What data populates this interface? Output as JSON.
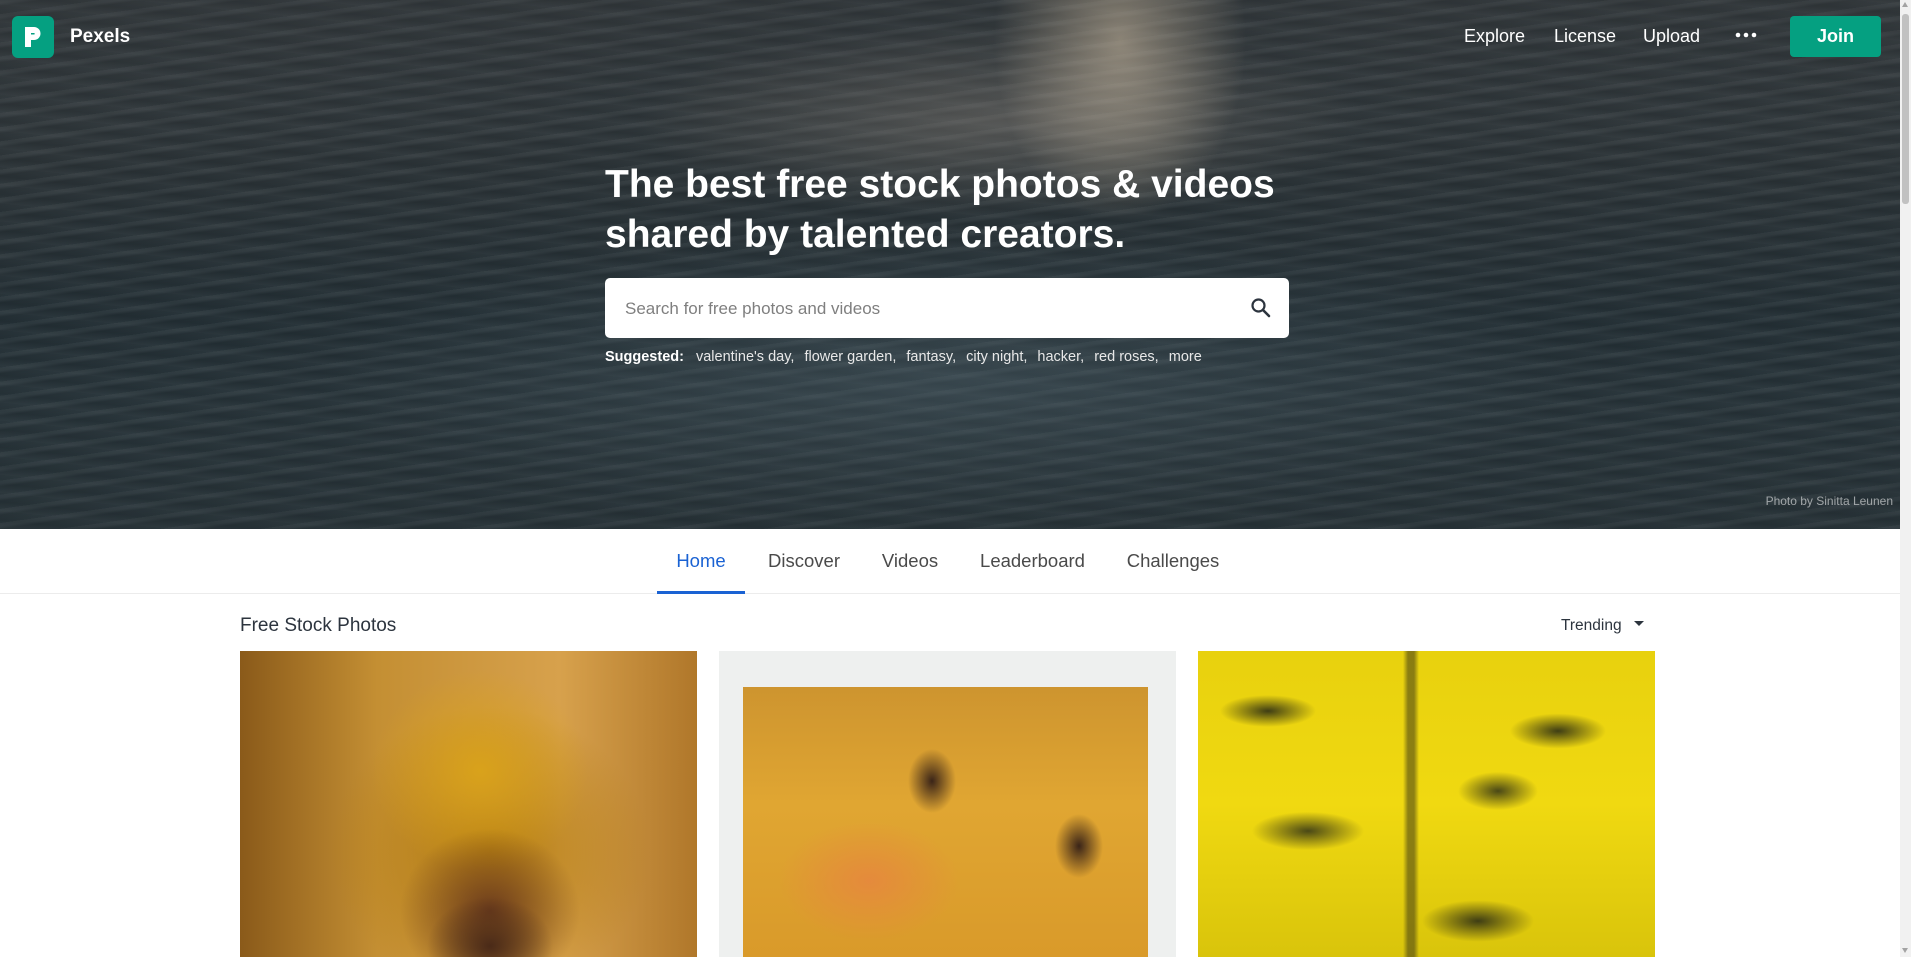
{
  "brand": {
    "name": "Pexels",
    "logo_icon": "pexels-p-logo",
    "accent": "#05a081"
  },
  "nav": {
    "links": [
      "Explore",
      "License",
      "Upload"
    ],
    "more_icon": "ellipsis-icon",
    "join_label": "Join"
  },
  "hero": {
    "headline": "The best free stock photos & videos shared by talented creators.",
    "search_placeholder": "Search for free photos and videos",
    "search_icon": "search-icon",
    "suggested_label": "Suggested:",
    "suggested_tags": [
      "valentine's day",
      "flower garden",
      "fantasy",
      "city night",
      "hacker",
      "red roses",
      "more"
    ],
    "credit": "Photo by Sinitta Leunen"
  },
  "tabs": {
    "items": [
      "Home",
      "Discover",
      "Videos",
      "Leaderboard",
      "Challenges"
    ],
    "active": "Home",
    "active_color": "#1a62d3"
  },
  "section": {
    "title": "Free Stock Photos",
    "sort_label": "Trending"
  }
}
